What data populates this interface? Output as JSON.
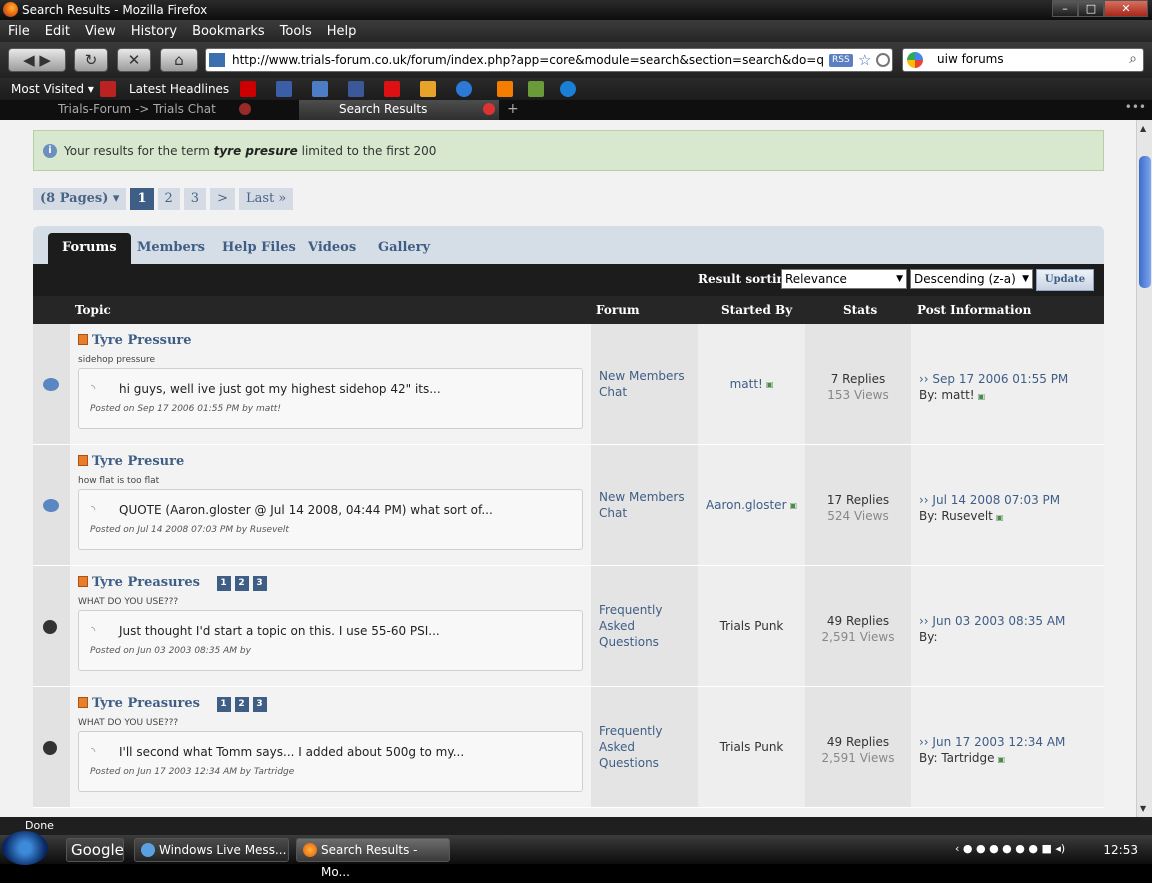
{
  "window": {
    "title": "Search Results - Mozilla Firefox"
  },
  "menu": [
    "File",
    "Edit",
    "View",
    "History",
    "Bookmarks",
    "Tools",
    "Help"
  ],
  "nav": {
    "url": "http://www.trials-forum.co.uk/forum/index.php?app=core&module=search&section=search&do=quick_search",
    "rss": "RSS",
    "search_value": "uiw forums"
  },
  "bookmarks": {
    "most_visited": "Most Visited ▾",
    "latest": "Latest Headlines"
  },
  "tabs": [
    {
      "label": "Trials-Forum -> Trials Chat"
    },
    {
      "label": "Search Results"
    }
  ],
  "notice": {
    "prefix": "Your results for the term",
    "term": "tyre presure",
    "suffix": "limited to the first 200"
  },
  "pager": {
    "pages": "(8 Pages)",
    "p1": "1",
    "p2": "2",
    "p3": "3",
    "next": ">",
    "last": "Last »"
  },
  "section_tabs": [
    "Forums",
    "Members",
    "Help Files",
    "Videos",
    "Gallery"
  ],
  "sort": {
    "label": "Result sorting",
    "field": "Relevance",
    "order": "Descending (z-a)",
    "update": "Update"
  },
  "columns": {
    "topic": "Topic",
    "forum": "Forum",
    "started": "Started By",
    "stats": "Stats",
    "post": "Post Information"
  },
  "rows": [
    {
      "title": "Tyre Pressure",
      "sub": "sidehop pressure",
      "snippet": "hi guys, well ive just got my highest sidehop 42\" its...",
      "meta": "Posted on Sep 17 2006 01:55 PM by matt!",
      "forum": "New Members Chat",
      "starter": "matt!",
      "replies": "7 Replies",
      "views": "153 Views",
      "date": "Sep 17 2006 01:55 PM",
      "by": "By: matt!"
    },
    {
      "title": "Tyre Presure",
      "sub": "how flat is too flat",
      "snippet": "QUOTE (Aaron.gloster @ Jul 14 2008, 04:44 PM) what sort of...",
      "meta": "Posted on Jul 14 2008 07:03 PM by Rusevelt",
      "forum": "New Members Chat",
      "starter": "Aaron.gloster",
      "replies": "17 Replies",
      "views": "524 Views",
      "date": "Jul 14 2008 07:03 PM",
      "by": "By: Rusevelt"
    },
    {
      "title": "Tyre Preasures",
      "sub": "WHAT DO YOU USE???",
      "snippet": "Just thought I'd start a topic on this. I use 55-60 PSI...",
      "meta": "Posted on Jun 03 2003 08:35 AM by",
      "forum": "Frequently Asked Questions",
      "starter": "Trials Punk",
      "replies": "49 Replies",
      "views": "2,591 Views",
      "date": "Jun 03 2003 08:35 AM",
      "by": "By:"
    },
    {
      "title": "Tyre Preasures",
      "sub": "WHAT DO YOU USE???",
      "snippet": "I'll second what Tomm says... I added about 500g to my...",
      "meta": "Posted on Jun 17 2003 12:34 AM by Tartridge",
      "forum": "Frequently Asked Questions",
      "starter": "Trials Punk",
      "replies": "49 Replies",
      "views": "2,591 Views",
      "date": "Jun 17 2003 12:34 AM",
      "by": "By: Tartridge"
    }
  ],
  "page_nums": [
    "1",
    "2",
    "3"
  ],
  "status": "Done",
  "taskbar": {
    "google": "Google",
    "msn": "Windows Live Mess...",
    "ff": "Search Results - Mo...",
    "clock": "12:53"
  }
}
